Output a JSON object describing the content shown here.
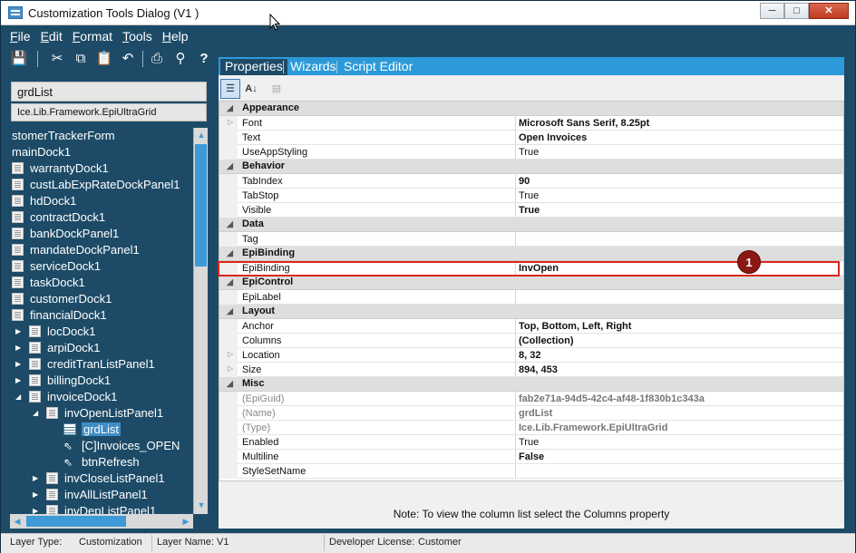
{
  "window": {
    "title": "Customization Tools Dialog  (V1 )"
  },
  "menu": [
    {
      "label": "File",
      "hotkey": "F",
      "rest": "ile"
    },
    {
      "label": "Edit",
      "hotkey": "E",
      "rest": "dit"
    },
    {
      "label": "Format",
      "hotkey": "F",
      "rest": "ormat"
    },
    {
      "label": "Tools",
      "hotkey": "T",
      "rest": "ools"
    },
    {
      "label": "Help",
      "hotkey": "H",
      "rest": "elp"
    }
  ],
  "toolbar_icons": [
    "save-icon",
    "cut-icon",
    "copy-icon",
    "paste-icon",
    "undo-icon",
    "print-icon",
    "find-icon",
    "help-icon"
  ],
  "left": {
    "control_name": "grdList",
    "control_type": "Ice.Lib.Framework.EpiUltraGrid",
    "tree": [
      {
        "label": "stomerTrackerForm",
        "level": 0
      },
      {
        "label": "mainDock1",
        "level": 0
      },
      {
        "label": "warrantyDock1",
        "level": 1
      },
      {
        "label": "custLabExpRateDockPanel1",
        "level": 1
      },
      {
        "label": "hdDock1",
        "level": 1
      },
      {
        "label": "contractDock1",
        "level": 1
      },
      {
        "label": "bankDockPanel1",
        "level": 1
      },
      {
        "label": "mandateDockPanel1",
        "level": 1
      },
      {
        "label": "serviceDock1",
        "level": 1
      },
      {
        "label": "taskDock1",
        "level": 1
      },
      {
        "label": "customerDock1",
        "level": 1
      },
      {
        "label": "financialDock1",
        "level": 1
      },
      {
        "label": "locDock1",
        "level": 2,
        "expander": "collapsed"
      },
      {
        "label": "arpiDock1",
        "level": 2,
        "expander": "collapsed"
      },
      {
        "label": "creditTranListPanel1",
        "level": 2,
        "expander": "collapsed"
      },
      {
        "label": "billingDock1",
        "level": 2,
        "expander": "collapsed"
      },
      {
        "label": "invoiceDock1",
        "level": 2,
        "expander": "expanded"
      },
      {
        "label": "invOpenListPanel1",
        "level": 3,
        "expander": "expanded"
      },
      {
        "label": "grdList",
        "level": 4,
        "icon": "grid",
        "selected": true
      },
      {
        "label": "[C]Invoices_OPEN",
        "level": 4,
        "icon": "cursor"
      },
      {
        "label": "btnRefresh",
        "level": 4,
        "icon": "cursor"
      },
      {
        "label": "invCloseListPanel1",
        "level": 3,
        "expander": "collapsed"
      },
      {
        "label": "invAllListPanel1",
        "level": 3,
        "expander": "collapsed"
      },
      {
        "label": "invDepListPanel1",
        "level": 3,
        "expander": "collapsed"
      }
    ]
  },
  "tabs": [
    {
      "label": "Properties",
      "active": true
    },
    {
      "label": "Wizards",
      "active": false
    },
    {
      "label": "Script Editor",
      "active": false
    }
  ],
  "property_grid": [
    {
      "kind": "cat",
      "name": "Appearance"
    },
    {
      "kind": "prop",
      "name": "Font",
      "value": "Microsoft Sans Serif, 8.25pt",
      "bold": true,
      "expandable": true
    },
    {
      "kind": "prop",
      "name": "Text",
      "value": "Open Invoices",
      "bold": true
    },
    {
      "kind": "prop",
      "name": "UseAppStyling",
      "value": "True"
    },
    {
      "kind": "cat",
      "name": "Behavior"
    },
    {
      "kind": "prop",
      "name": "TabIndex",
      "value": "90",
      "bold": true
    },
    {
      "kind": "prop",
      "name": "TabStop",
      "value": "True"
    },
    {
      "kind": "prop",
      "name": "Visible",
      "value": "True",
      "bold": true
    },
    {
      "kind": "cat",
      "name": "Data"
    },
    {
      "kind": "prop",
      "name": "Tag",
      "value": ""
    },
    {
      "kind": "cat",
      "name": "EpiBinding"
    },
    {
      "kind": "prop",
      "name": "EpiBinding",
      "value": "InvOpen",
      "bold": true,
      "highlight": true
    },
    {
      "kind": "cat",
      "name": "EpiControl"
    },
    {
      "kind": "prop",
      "name": "EpiLabel",
      "value": ""
    },
    {
      "kind": "cat",
      "name": "Layout"
    },
    {
      "kind": "prop",
      "name": "Anchor",
      "value": "Top, Bottom, Left, Right",
      "bold": true
    },
    {
      "kind": "prop",
      "name": "Columns",
      "value": "(Collection)",
      "bold": true
    },
    {
      "kind": "prop",
      "name": "Location",
      "value": "8, 32",
      "bold": true,
      "expandable": true
    },
    {
      "kind": "prop",
      "name": "Size",
      "value": "894, 453",
      "bold": true,
      "expandable": true
    },
    {
      "kind": "cat",
      "name": "Misc"
    },
    {
      "kind": "prop",
      "name": "(EpiGuid)",
      "value": "fab2e71a-94d5-42c4-af48-1f830b1c343a",
      "dim": true
    },
    {
      "kind": "prop",
      "name": "(Name)",
      "value": "grdList",
      "dim": true
    },
    {
      "kind": "prop",
      "name": "(Type)",
      "value": "Ice.Lib.Framework.EpiUltraGrid",
      "dim": true
    },
    {
      "kind": "prop",
      "name": "Enabled",
      "value": "True"
    },
    {
      "kind": "prop",
      "name": "Multiline",
      "value": "False",
      "bold": true
    },
    {
      "kind": "prop",
      "name": "StyleSetName",
      "value": ""
    }
  ],
  "callout": "1",
  "note": "Note:  To view the column list select the Columns property",
  "status": {
    "layer_type_label": "Layer Type:",
    "layer_type_value": "Customization",
    "layer_name_label": "Layer Name:",
    "layer_name_value": "V1",
    "license_label": "Developer License:",
    "license_value": "Customer"
  },
  "colors": {
    "chrome": "#1d4b67",
    "accent": "#2c9ad8",
    "highlight": "#d9281c",
    "callout": "#8b1812"
  }
}
